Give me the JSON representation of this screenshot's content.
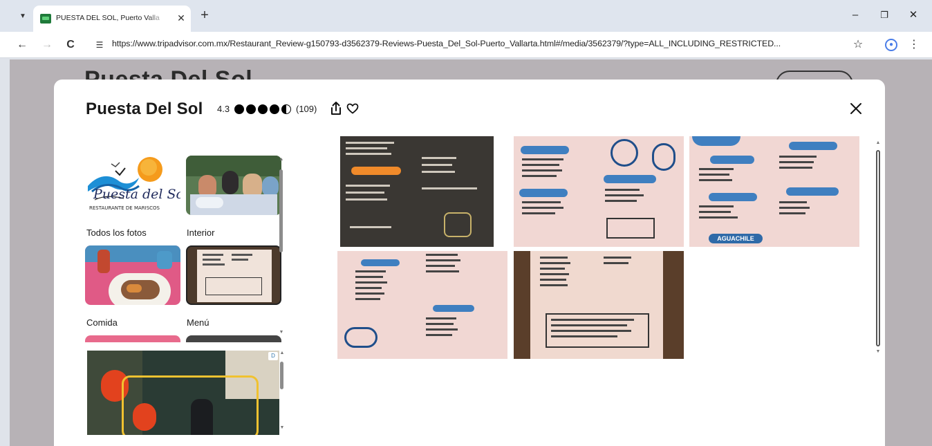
{
  "browser": {
    "tab_title": "PUESTA DEL SOL, Puerto Valla",
    "url": "https://www.tripadvisor.com.mx/Restaurant_Review-g150793-d3562379-Reviews-Puesta_Del_Sol-Puerto_Vallarta.html#/media/3562379/?type=ALL_INCLUDING_RESTRICTED...",
    "icons": [
      "tab-list-icon",
      "close-icon",
      "plus-icon",
      "minimize-icon",
      "restore-icon",
      "back-arrow-icon",
      "forward-arrow-icon",
      "reload-icon",
      "site-info-icon",
      "star-icon",
      "profile-icon",
      "kebab-icon"
    ]
  },
  "page": {
    "bg_title": "Puesta Del Sol"
  },
  "modal": {
    "title": "Puesta Del Sol",
    "rating": "4.3",
    "rating_value": 4.5,
    "review_count": "(109)",
    "categories": [
      {
        "label": "Todos los fotos"
      },
      {
        "label": "Interior"
      },
      {
        "label": "Comida"
      },
      {
        "label": "Menú"
      }
    ],
    "logo_text": {
      "script": "Puesta del Sol",
      "caption": "RESTAURANTE DE MARISCOS"
    },
    "menu_badge": "AGUACHILE",
    "ad_badge": "D"
  },
  "colors": {
    "tab_strip": "#dfe5ee",
    "overlay": "#b7b2b6",
    "menu_pink": "#f1d7d3",
    "menu_blue": "#3f7fc0",
    "dark_menu": "#3a3733",
    "accent_orange": "#f08a2a"
  }
}
